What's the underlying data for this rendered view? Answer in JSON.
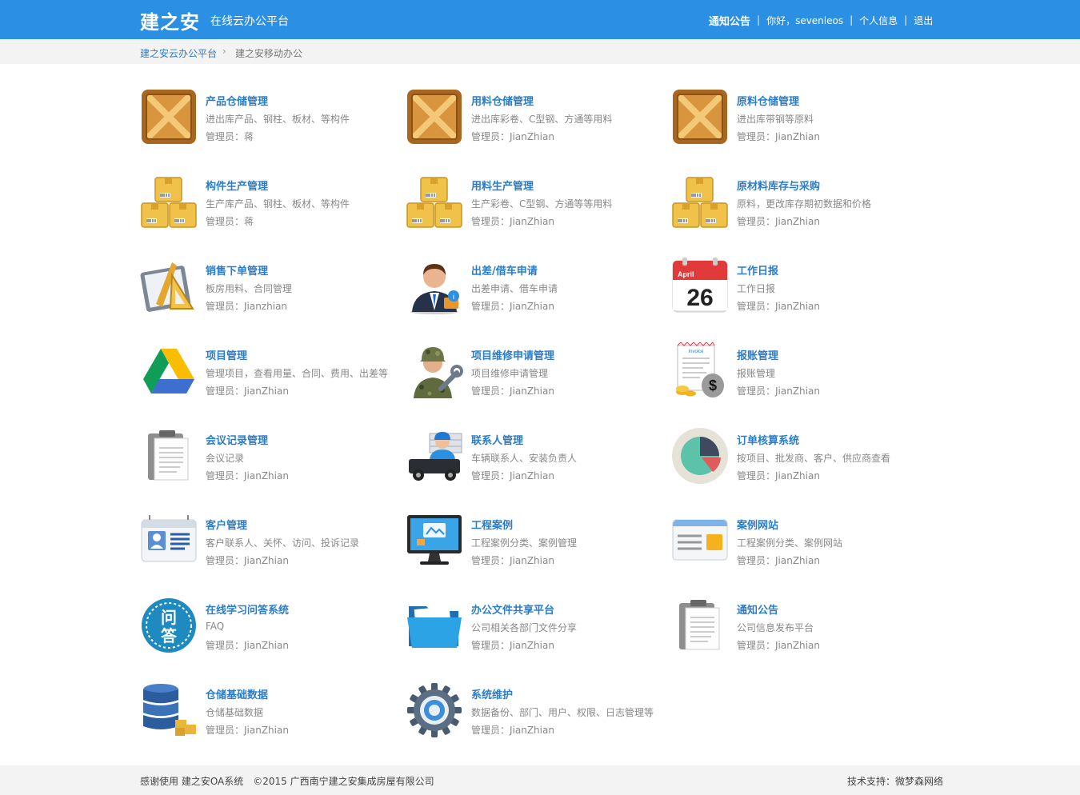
{
  "header": {
    "brand": "建之安",
    "subtitle": "在线云办公平台",
    "nav": {
      "notice": "通知公告",
      "greeting": "你好，sevenleos",
      "profile": "个人信息",
      "logout": "退出",
      "separator": "|"
    }
  },
  "breadcrumb": {
    "home": "建之安云办公平台",
    "arrow": "›",
    "current": "建之安移动办公"
  },
  "modules": [
    {
      "title": "产品仓储管理",
      "desc": "进出库产品、钢柱、板材、等构件",
      "manager": "管理员：蒋",
      "icon": "crate-icon"
    },
    {
      "title": "用料仓储管理",
      "desc": "进出库彩卷、C型钢、方通等用料",
      "manager": "管理员：JianZhian",
      "icon": "crate-icon"
    },
    {
      "title": "原料仓储管理",
      "desc": "进出库带钢等原料",
      "manager": "管理员：JianZhian",
      "icon": "crate-icon"
    },
    {
      "title": "构件生产管理",
      "desc": "生产库产品、钢柱、板材、等构件",
      "manager": "管理员：蒋",
      "icon": "boxes-icon"
    },
    {
      "title": "用料生产管理",
      "desc": "生产彩卷、C型钢、方通等等用料",
      "manager": "管理员：JianZhian",
      "icon": "boxes-icon"
    },
    {
      "title": "原材料库存与采购",
      "desc": "原料，更改库存期初数据和价格",
      "manager": "管理员：JianZhian",
      "icon": "boxes-icon"
    },
    {
      "title": "销售下单管理",
      "desc": "板房用料、合同管理",
      "manager": "管理员：Jianzhian",
      "icon": "drafting-icon"
    },
    {
      "title": "出差/借车申请",
      "desc": "出差申请、借车申请",
      "manager": "管理员：JianZhian",
      "icon": "businessman-icon"
    },
    {
      "title": "工作日报",
      "desc": "工作日报",
      "manager": "管理员：JianZhian",
      "icon": "calendar-icon",
      "cal_month": "April",
      "cal_day": "26"
    },
    {
      "title": "项目管理",
      "desc": "管理项目，查看用量、合同、费用、出差等",
      "manager": "管理员：JianZhian",
      "icon": "drive-icon"
    },
    {
      "title": "项目维修申请管理",
      "desc": "项目维修申请管理",
      "manager": "管理员：JianZhian",
      "icon": "repairman-icon"
    },
    {
      "title": "报账管理",
      "desc": "报账管理",
      "manager": "管理员：JianZhian",
      "icon": "invoice-icon",
      "invoice_label": "Invoice"
    },
    {
      "title": "会议记录管理",
      "desc": "会议记录",
      "manager": "管理员：JianZhian",
      "icon": "clipboard-icon"
    },
    {
      "title": "联系人管理",
      "desc": "车辆联系人、安装负责人",
      "manager": "管理员：JianZhian",
      "icon": "truck-driver-icon"
    },
    {
      "title": "订单核算系统",
      "desc": "按项目、批发商、客户、供应商查看",
      "manager": "管理员：JianZhian",
      "icon": "pie-chart-icon"
    },
    {
      "title": "客户管理",
      "desc": "客户联系人、关怀、访问、投诉记录",
      "manager": "管理员：JianZhian",
      "icon": "contact-card-icon"
    },
    {
      "title": "工程案例",
      "desc": "工程案例分类、案例管理",
      "manager": "管理员：JianZhian",
      "icon": "monitor-icon"
    },
    {
      "title": "案例网站",
      "desc": "工程案例分类、案例网站",
      "manager": "管理员：JianZhian",
      "icon": "browser-icon"
    },
    {
      "title": "在线学习问答系统",
      "desc": "FAQ",
      "manager": "管理员：JianZhian",
      "icon": "qa-badge-icon",
      "badge_top": "问",
      "badge_bottom": "答"
    },
    {
      "title": "办公文件共享平台",
      "desc": "公司相关各部门文件分享",
      "manager": "管理员：JianZhian",
      "icon": "folder-icon"
    },
    {
      "title": "通知公告",
      "desc": "公司信息发布平台",
      "manager": "管理员：JianZhian",
      "icon": "clipboard-icon"
    },
    {
      "title": "仓储基础数据",
      "desc": "仓储基础数据",
      "manager": "管理员：JianZhian",
      "icon": "database-icon"
    },
    {
      "title": "系统维护",
      "desc": "数据备份、部门、用户、权限、日志管理等",
      "manager": "管理员：JianZhian",
      "icon": "gear-icon"
    }
  ],
  "footer": {
    "left": "感谢使用 建之安OA系统　©2015 广西南宁建之安集成房屋有限公司",
    "right": "技术支持：微梦森网络"
  }
}
